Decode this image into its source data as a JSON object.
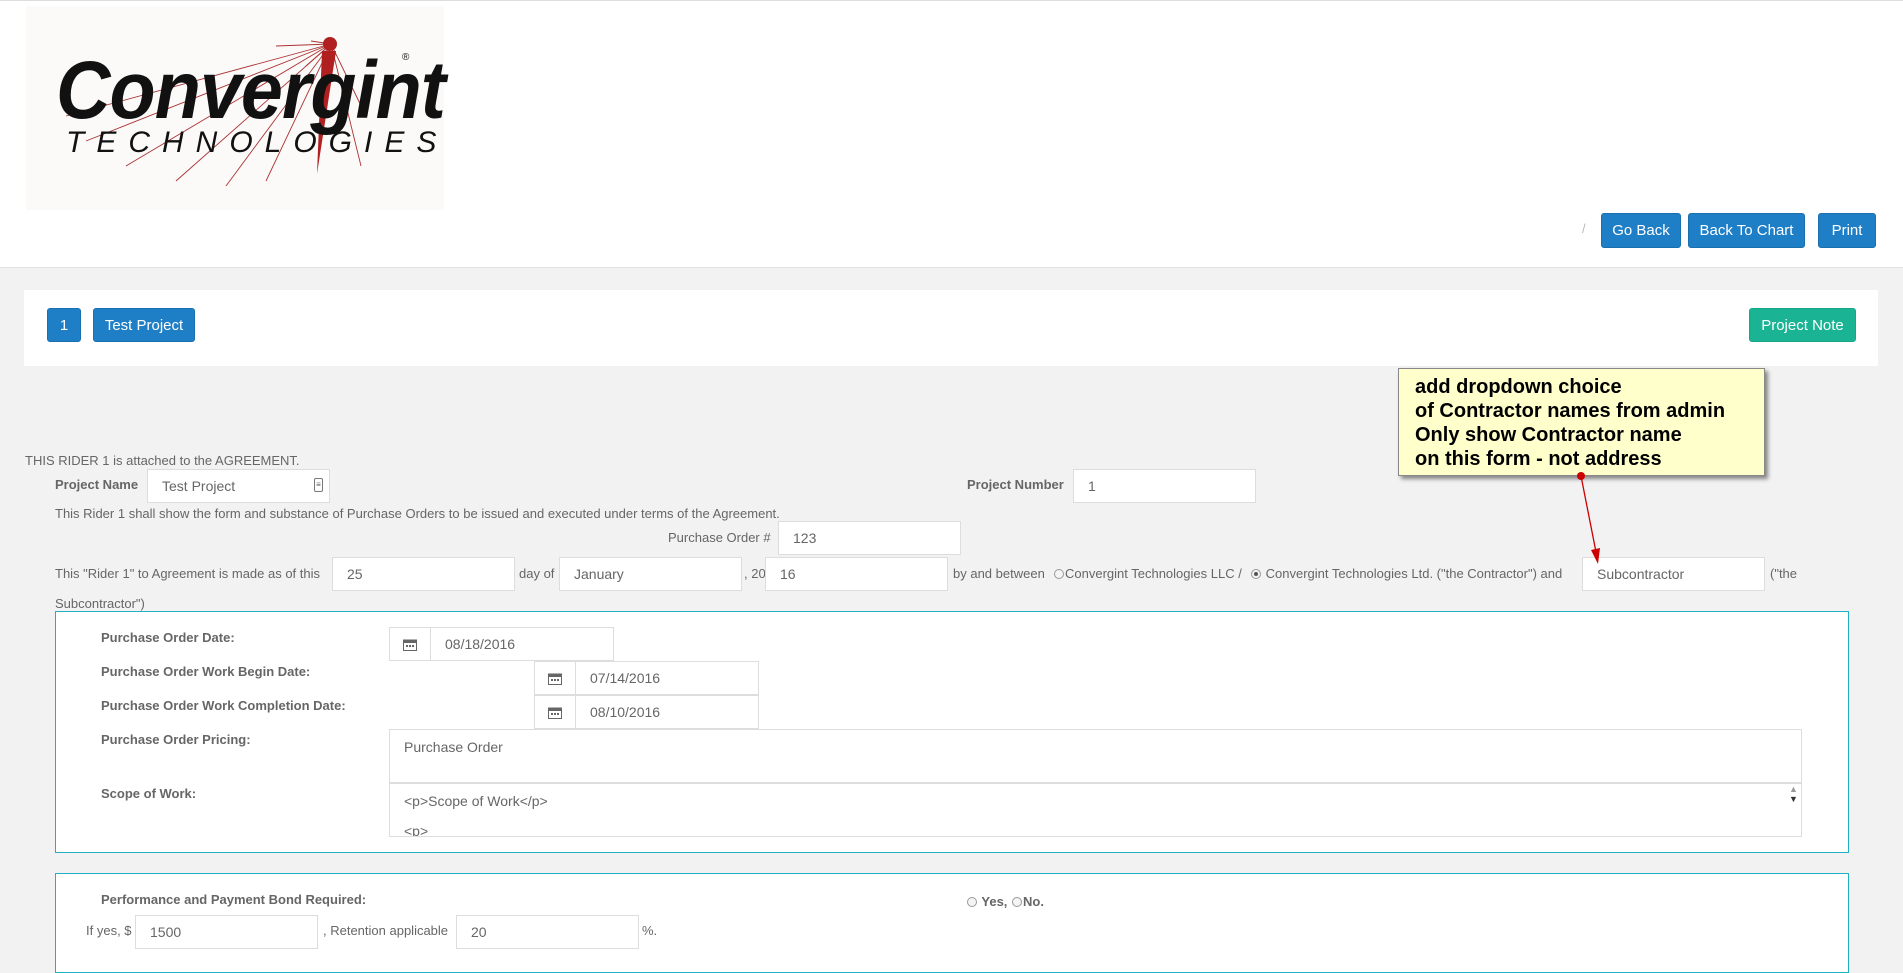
{
  "logo": {
    "name": "Convergint",
    "subtitle": "TECHNOLOGIES",
    "reg": "®"
  },
  "header": {
    "separator": "/",
    "go_back": "Go Back",
    "back_to_chart": "Back To Chart",
    "print": "Print"
  },
  "project_bar": {
    "number_btn": "1",
    "name_btn": "Test Project",
    "note_btn": "Project Note"
  },
  "annotation": {
    "lines": [
      "add dropdown choice",
      "of Contractor names from admin",
      "Only show Contractor name",
      "on this form - not address"
    ],
    "color": "#ffffcc",
    "arrow_color": "#cc0000"
  },
  "form": {
    "intro": "THIS RIDER 1 is attached to the AGREEMENT.",
    "project_name_label": "Project Name",
    "project_name_value": "Test Project",
    "project_number_label": "Project Number",
    "project_number_value": "1",
    "rider_desc": "This Rider 1 shall show the form and substance of Purchase Orders to be issued and executed under terms of the Agreement.",
    "po_number_label": "Purchase Order #",
    "po_number_value": "123",
    "made_as_of": "This \"Rider 1\" to Agreement is made as of this",
    "day_value": "25",
    "day_of": "day of",
    "month_value": "January",
    "year_prefix": ", 20",
    "year_value": "16",
    "by_between": "by and between",
    "contractor_option_1": "Convergint Technologies LLC /",
    "contractor_option_2": "Convergint Technologies Ltd. (\"the Contractor\") and",
    "subcontractor_value": "Subcontractor",
    "the_label": "(\"the",
    "subcontractor_suffix": "Subcontractor\")"
  },
  "po_panel": {
    "po_date_label": "Purchase Order Date:",
    "po_date_value": "08/18/2016",
    "begin_label": "Purchase Order Work Begin Date:",
    "begin_value": "07/14/2016",
    "completion_label": "Purchase Order Work Completion Date:",
    "completion_value": "08/10/2016",
    "pricing_label": "Purchase Order Pricing:",
    "pricing_value": "Purchase Order",
    "scope_label": "Scope of Work:",
    "scope_value": "<p>Scope of Work</p>",
    "scope_partial": "<p>"
  },
  "bond_panel": {
    "bond_label": "Performance and Payment Bond Required:",
    "yes_label": "Yes,",
    "no_label": "No.",
    "if_yes": "If yes, $",
    "amount_value": "1500",
    "retention_label": ", Retention applicable",
    "retention_value": "20",
    "percent": "%."
  }
}
